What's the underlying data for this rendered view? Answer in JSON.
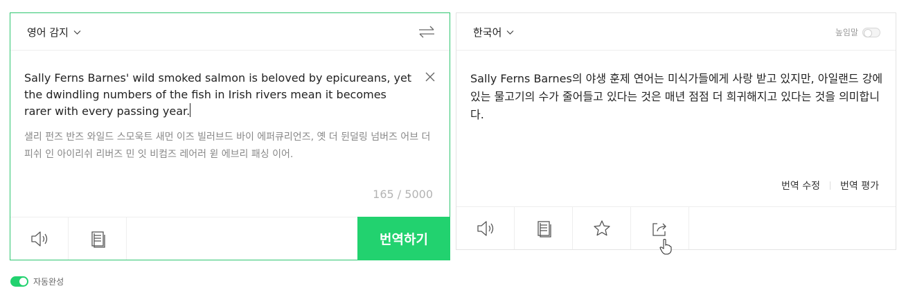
{
  "source": {
    "language": "영어 감지",
    "text": "Sally Ferns Barnes' wild smoked salmon is beloved by epicureans, yet the dwindling numbers of the fish in Irish rivers mean it becomes rarer with every passing year.",
    "pronunciation": "샐리 펀즈 반즈 와일드 스모욱트 새먼 이즈 빌러브드 바이 에퍼큐리언즈, 옛 더 뒨덜링 넘버즈 어브 더 피쉬 인 아이리쉬 리버즈 민 잇 비컴즈 레어러 윋 에브리 패싱 이어.",
    "char_count": "165 / 5000",
    "translate_button": "번역하기"
  },
  "target": {
    "language": "한국어",
    "honorific_label": "높임말",
    "text": "Sally Ferns Barnes의 야생 훈제 연어는 미식가들에게 사랑 받고 있지만, 아일랜드 강에 있는 물고기의 수가 줄어들고 있다는 것은 매년 점점 더 희귀해지고 있다는 것을 의미합니다.",
    "edit_translation": "번역 수정",
    "rate_translation": "번역 평가"
  },
  "footer": {
    "autocomplete_label": "자동완성"
  },
  "icons": {
    "swap": "swap-arrows-icon",
    "clear": "close-icon",
    "speaker": "speaker-icon",
    "copy": "copy-icon",
    "star": "star-icon",
    "share": "share-icon"
  },
  "colors": {
    "accent": "#22d26f",
    "border_active": "#2dc56f"
  }
}
